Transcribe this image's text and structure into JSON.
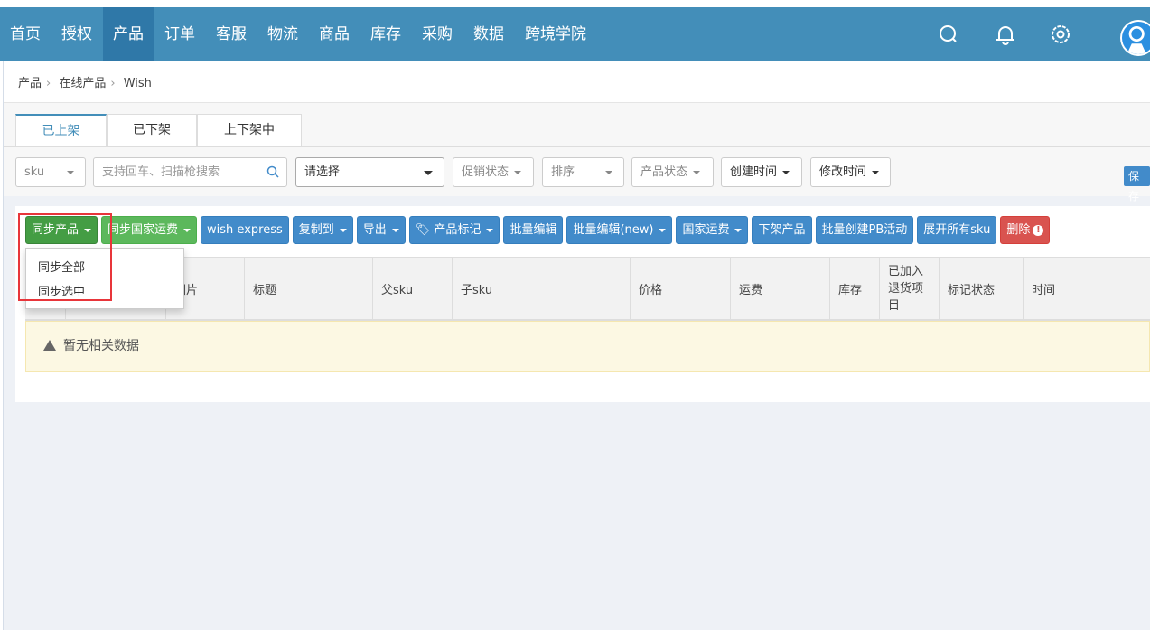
{
  "nav": {
    "items": [
      "首页",
      "授权",
      "产品",
      "订单",
      "客服",
      "物流",
      "商品",
      "库存",
      "采购",
      "数据",
      "跨境学院"
    ],
    "active": 2,
    "icons": [
      "search-icon",
      "bell-icon",
      "gear-icon",
      "avatar"
    ]
  },
  "breadcrumb": [
    "产品",
    "在线产品",
    "Wish"
  ],
  "tabs": [
    "已上架",
    "已下架",
    "上下架中"
  ],
  "filters": {
    "sku": "sku",
    "search_placeholder": "支持回车、扫描枪搜索",
    "select": "请选择",
    "promo": "促销状态",
    "sort": "排序",
    "status": "产品状态",
    "created": "创建时间",
    "modified": "修改时间",
    "save": "保存"
  },
  "actions": [
    "同步产品",
    "同步国家运费",
    "wish express",
    "复制到",
    "导出",
    "产品标记",
    "批量编辑",
    "批量编辑(new)",
    "国家运费",
    "下架产品",
    "批量创建PB活动",
    "展开所有sku",
    "删除"
  ],
  "dropdown": [
    "同步全部",
    "同步选中"
  ],
  "table": {
    "headers": [
      "",
      "",
      "图片",
      "标题",
      "父sku",
      "子sku",
      "价格",
      "运费",
      "库存",
      "已加入退货项目",
      "标记状态",
      "时间"
    ],
    "empty": "暂无相关数据"
  },
  "colors": {
    "nav": "#438eb9",
    "primary": "#428bca",
    "success": "#5cb85c",
    "danger": "#d9534f",
    "highlight": "#e8353a"
  }
}
